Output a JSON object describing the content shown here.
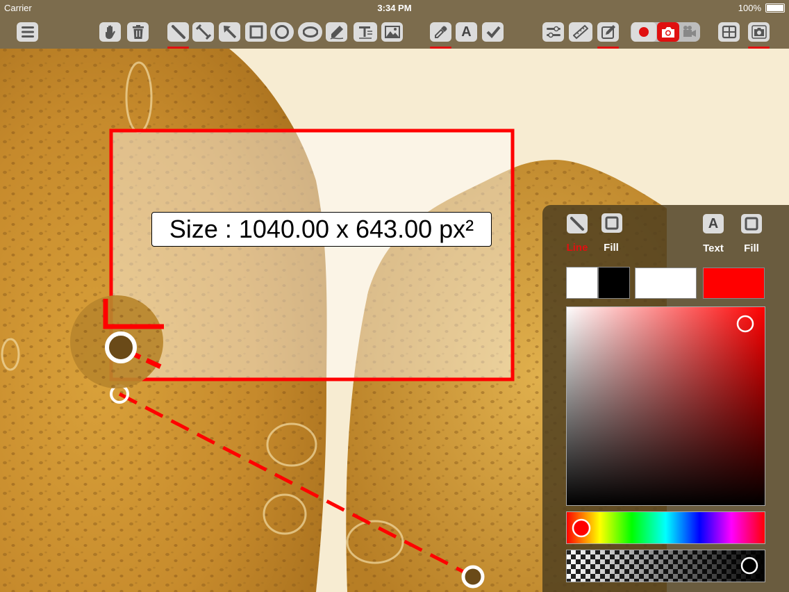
{
  "status_bar": {
    "carrier": "Carrier",
    "time": "3:34 PM",
    "battery": "100%"
  },
  "toolbar": {
    "items": [
      {
        "name": "menu",
        "icon": "menu-icon"
      },
      {
        "name": "pan",
        "icon": "hand-icon"
      },
      {
        "name": "delete",
        "icon": "trash-icon"
      },
      {
        "name": "line",
        "icon": "line-tool-icon",
        "active": true
      },
      {
        "name": "measure-line",
        "icon": "measure-line-icon"
      },
      {
        "name": "arrow",
        "icon": "arrow-tool-icon"
      },
      {
        "name": "rectangle",
        "icon": "rectangle-tool-icon"
      },
      {
        "name": "circle",
        "icon": "circle-tool-icon"
      },
      {
        "name": "ellipse",
        "icon": "ellipse-tool-icon"
      },
      {
        "name": "pen",
        "icon": "pen-tool-icon"
      },
      {
        "name": "text",
        "icon": "text-tool-icon"
      },
      {
        "name": "image",
        "icon": "image-tool-icon"
      },
      {
        "name": "eyedropper",
        "icon": "eyedropper-icon",
        "active": true
      },
      {
        "name": "font",
        "icon": "font-icon",
        "label": "A"
      },
      {
        "name": "checkmark",
        "icon": "checkmark-icon"
      },
      {
        "name": "adjust",
        "icon": "sliders-icon"
      },
      {
        "name": "ruler",
        "icon": "ruler-icon"
      },
      {
        "name": "edit",
        "icon": "edit-icon",
        "active": true
      },
      {
        "name": "record",
        "icon": "record-icon"
      },
      {
        "name": "camera-red",
        "icon": "camera-icon"
      },
      {
        "name": "video",
        "icon": "video-camera-icon"
      },
      {
        "name": "grid",
        "icon": "grid-icon"
      },
      {
        "name": "snapshot",
        "icon": "snapshot-icon",
        "active": true
      }
    ]
  },
  "annotation": {
    "size_label": "Size : 1040.00 x 643.00 px²"
  },
  "panel": {
    "line_label": "Line",
    "fill_label_1": "Fill",
    "text_label": "Text",
    "fill_label_2": "Fill",
    "text_tool_glyph": "A",
    "colors": {
      "accent": "#e01010",
      "selected": "#ff0000",
      "line_swatch_a": "#ffffff",
      "line_swatch_b": "#000000",
      "fill_swatch": "#ffffff",
      "text_swatch": "#ff0000"
    }
  }
}
